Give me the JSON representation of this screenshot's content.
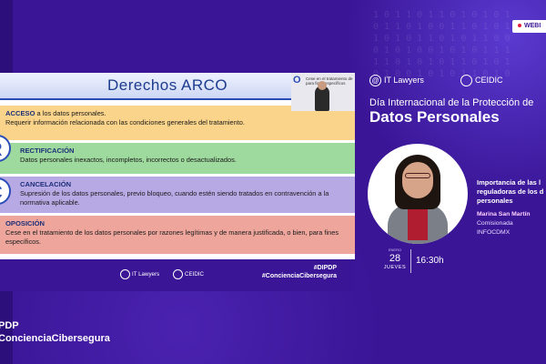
{
  "webinar_tag": "WEBI",
  "slide": {
    "title": "Derechos ARCO",
    "items": [
      {
        "heading": "ACCESO",
        "line1": " a los datos personales.",
        "line2": "Requerir información relacionada con las condiciones generales  del tratamiento."
      },
      {
        "heading": "RECTIFICACIÓN",
        "line1": "",
        "line2": "Datos personales inexactos, incompletos, incorrectos o desactualizados."
      },
      {
        "heading": "CANCELACIÓN",
        "line1": "",
        "line2": "Supresión de los datos personales, previo bloqueo, cuando estén siendo tratados en contravención a la normativa aplicable."
      },
      {
        "heading": "OPOSICIÓN",
        "line1": "",
        "line2": "Cese en el tratamiento de los datos personales por razones legítimas y  de manera justificada,  o bien, para fines específicos."
      }
    ],
    "letters": [
      "R",
      "C"
    ],
    "footer_logo_1": "IT Lawyers",
    "footer_logo_2": "CEIDIC",
    "hashtag_1": "#DIPDP",
    "hashtag_2": "#ConcienciaCibersegura"
  },
  "pip": {
    "badge": "O",
    "line1": "Cese en el tratamiento de",
    "line2": "para fines específicos"
  },
  "brand": {
    "it_lawyers": "IT Lawyers",
    "ceidic": "CEIDIC"
  },
  "event": {
    "line1": "Día Internacional de la Protección de",
    "line2": "Datos Personales"
  },
  "talk": {
    "line1": "Importancia de las l",
    "line2": "reguladoras de los d",
    "line3": "personales"
  },
  "speaker": {
    "name": "Marina San Martín",
    "role": "Comisionada",
    "org": "INFOCDMX"
  },
  "date": {
    "month": "ENERO",
    "day": "28",
    "weekday": "JUEVES",
    "time": "16:30h"
  },
  "bottom": {
    "hashtag_1": "PDP",
    "hashtag_2": "ConcienciaCibersegura"
  },
  "colors": {
    "background": "#3a1596",
    "accent": "#2b4db8"
  }
}
